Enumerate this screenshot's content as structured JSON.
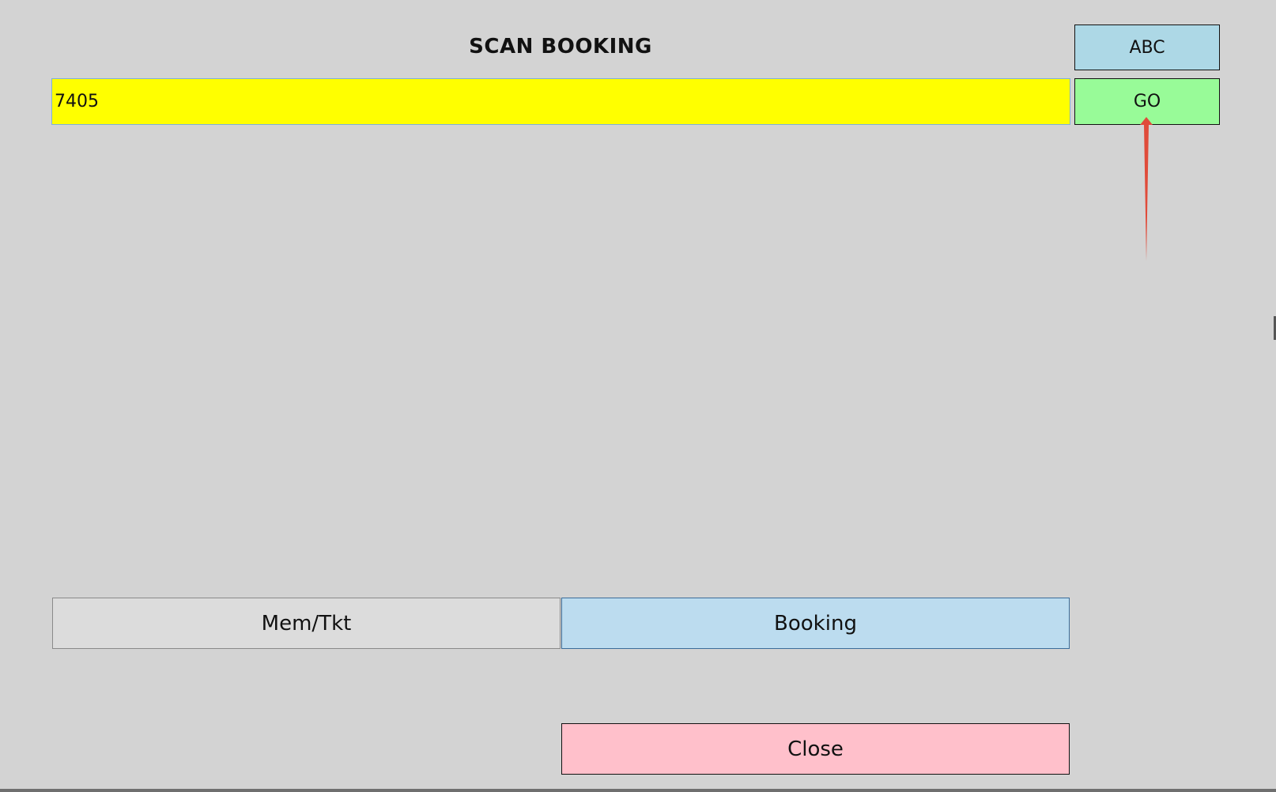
{
  "header": {
    "title": "SCAN BOOKING"
  },
  "scan": {
    "value": "7405",
    "placeholder": ""
  },
  "buttons": {
    "abc_label": "ABC",
    "go_label": "GO",
    "memtkt_label": "Mem/Tkt",
    "booking_label": "Booking",
    "close_label": "Close"
  },
  "colors": {
    "background": "#d3d3d3",
    "abc": "#add8e6",
    "go": "#98fb98",
    "input": "#ffff00",
    "booking": "#bcdcef",
    "memtkt": "#dcdcdc",
    "close": "#ffc0cb",
    "annotation_arrow": "#e04b3a"
  },
  "annotation": {
    "icon": "arrow-up-icon"
  }
}
